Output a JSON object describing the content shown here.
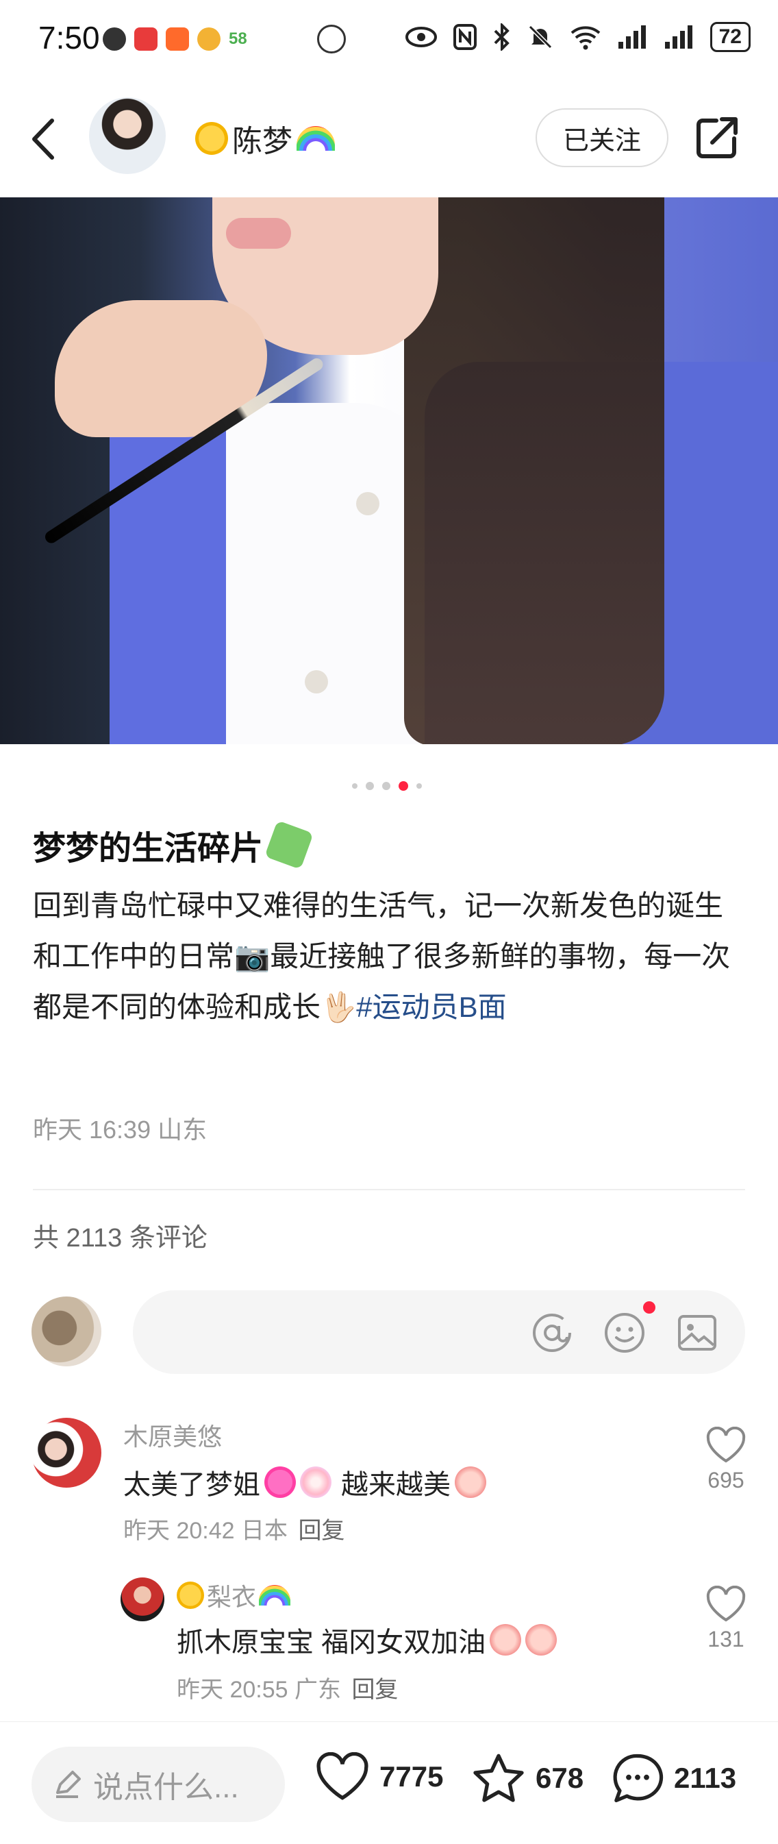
{
  "status_bar": {
    "time": "7:50",
    "notif_count": "58",
    "battery": "72"
  },
  "header": {
    "author_name": "陈梦",
    "follow_label": "已关注"
  },
  "carousel": {
    "total": 5,
    "active_index": 3
  },
  "post": {
    "title": "梦梦的生活碎片",
    "body": "回到青岛忙碌中又难得的生活气，记一次新发色的诞生和工作中的日常📷最近接触了很多新鲜的事物，每一次都是不同的体验和成长🖖🏻",
    "hashtag": "#运动员B面",
    "time": "昨天 16:39",
    "location": "山东"
  },
  "comments_section": {
    "count_label": "共 2113 条评论",
    "comments": [
      {
        "user": "木原美悠",
        "text": "太美了梦姐",
        "text2": "越来越美",
        "time": "昨天 20:42",
        "location": "日本",
        "reply_label": "回复",
        "likes": "695"
      },
      {
        "user": "梨衣",
        "text": "抓木原宝宝 福冈女双加油",
        "time": "昨天 20:55",
        "location": "广东",
        "reply_label": "回复",
        "likes": "131"
      }
    ]
  },
  "bottom_bar": {
    "input_placeholder": "说点什么...",
    "likes": "7775",
    "favorites": "678",
    "comments": "2113"
  },
  "colors": {
    "accent": "#ff2442",
    "hashtag": "#264e8a"
  }
}
